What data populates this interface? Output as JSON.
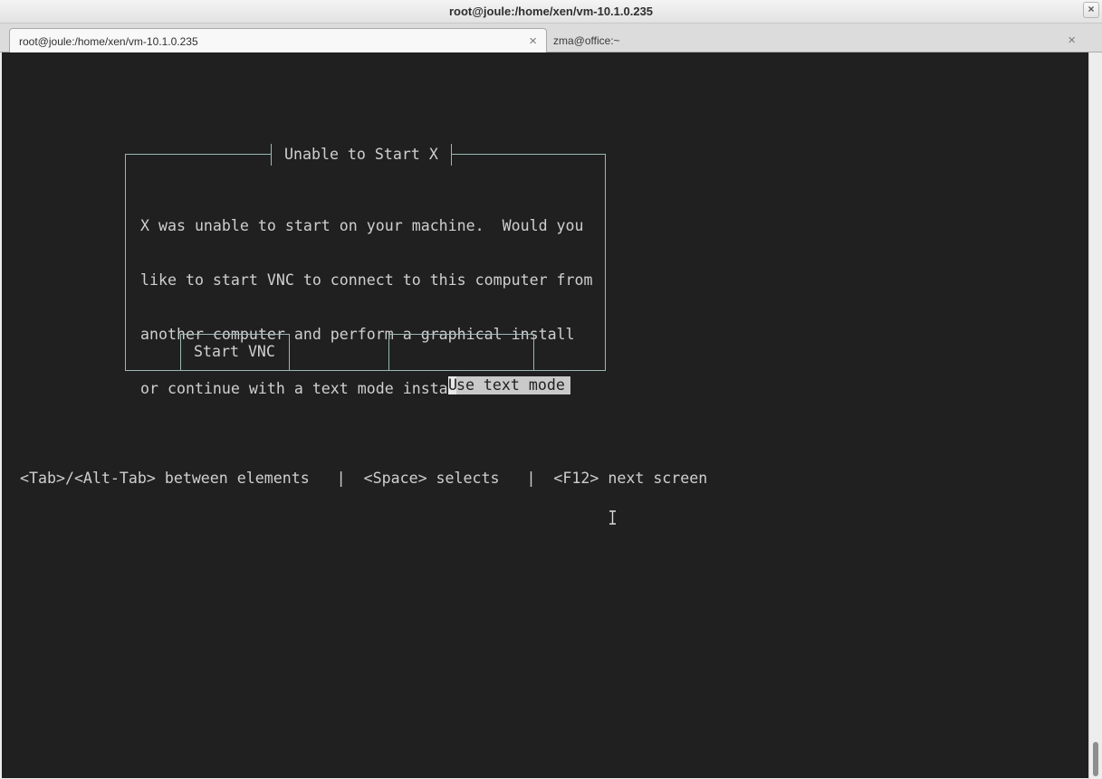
{
  "window": {
    "title": "root@joule:/home/xen/vm-10.1.0.235",
    "close_glyph": "×"
  },
  "tabs": [
    {
      "label": "root@joule:/home/xen/vm-10.1.0.235",
      "close_glyph": "×"
    },
    {
      "label": "zma@office:~",
      "close_glyph": "×"
    }
  ],
  "dialog": {
    "title": "Unable to Start X",
    "message_lines": [
      "X was unable to start on your machine.  Would you",
      "like to start VNC to connect to this computer from",
      "another computer and perform a graphical install",
      "or continue with a text mode install?"
    ],
    "buttons": {
      "vnc": "Start VNC",
      "text_mode_first": "U",
      "text_mode_rest": "se text mode"
    }
  },
  "help": {
    "line": "<Tab>/<Alt-Tab> between elements   |  <Space> selects   |  <F12> next screen"
  },
  "colors": {
    "terminal_bg": "#202020",
    "terminal_fg": "#cfcfcf",
    "dialog_border": "#9ab8b4",
    "selected_bg": "#c9c9c9"
  },
  "icons": {
    "mouse_cursor": "text-cursor-icon"
  }
}
